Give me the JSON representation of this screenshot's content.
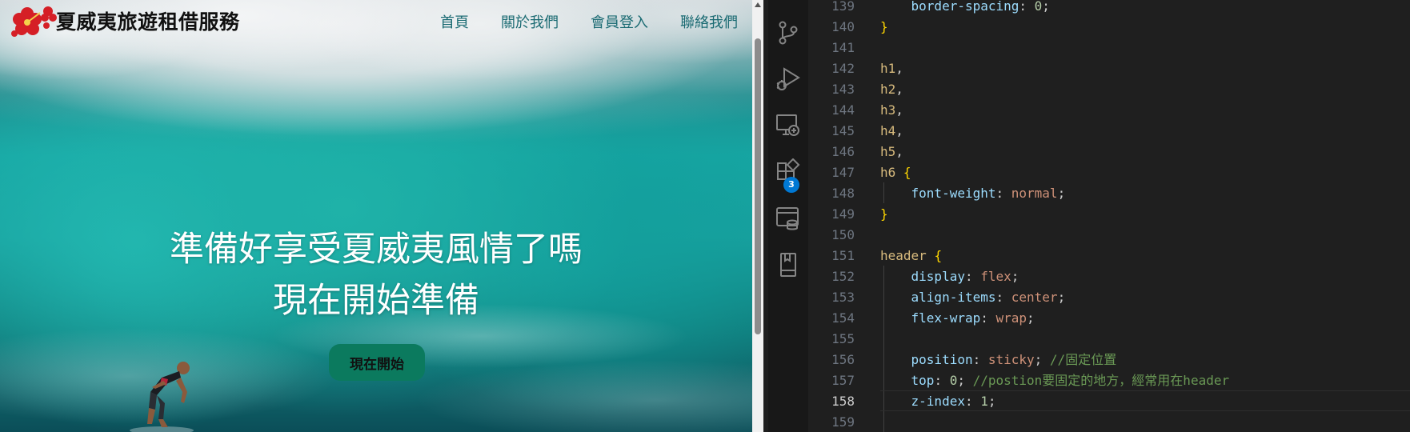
{
  "browser": {
    "brand": "夏威夷旅遊租借服務",
    "nav": [
      {
        "label": "首頁"
      },
      {
        "label": "關於我們"
      },
      {
        "label": "會員登入"
      },
      {
        "label": "聯絡我們"
      }
    ],
    "hero": {
      "line1": "準備好享受夏威夷風情了嗎",
      "line2": "現在開始準備",
      "cta": "現在開始"
    },
    "logo_color": "#d51f26",
    "nav_color": "#1b6b73",
    "cta_color": "#0b7a5e"
  },
  "vscode": {
    "activity_icons": [
      "source-control-icon",
      "run-debug-icon",
      "remote-explorer-icon",
      "extensions-icon",
      "database-icon",
      "bookmark-icon"
    ],
    "extensions_badge": "3",
    "active_line": 158,
    "lines": [
      {
        "n": "139",
        "tokens": [
          {
            "t": "    ",
            "c": "punc"
          },
          {
            "t": "border-spacing",
            "c": "prop"
          },
          {
            "t": ": ",
            "c": "punc"
          },
          {
            "t": "0",
            "c": "num"
          },
          {
            "t": ";",
            "c": "punc"
          }
        ]
      },
      {
        "n": "140",
        "tokens": [
          {
            "t": "}",
            "c": "brace"
          }
        ]
      },
      {
        "n": "141",
        "tokens": []
      },
      {
        "n": "142",
        "tokens": [
          {
            "t": "h1",
            "c": "sel"
          },
          {
            "t": ",",
            "c": "punc"
          }
        ]
      },
      {
        "n": "143",
        "tokens": [
          {
            "t": "h2",
            "c": "sel"
          },
          {
            "t": ",",
            "c": "punc"
          }
        ]
      },
      {
        "n": "144",
        "tokens": [
          {
            "t": "h3",
            "c": "sel"
          },
          {
            "t": ",",
            "c": "punc"
          }
        ]
      },
      {
        "n": "145",
        "tokens": [
          {
            "t": "h4",
            "c": "sel"
          },
          {
            "t": ",",
            "c": "punc"
          }
        ]
      },
      {
        "n": "146",
        "tokens": [
          {
            "t": "h5",
            "c": "sel"
          },
          {
            "t": ",",
            "c": "punc"
          }
        ]
      },
      {
        "n": "147",
        "tokens": [
          {
            "t": "h6",
            "c": "sel"
          },
          {
            "t": " ",
            "c": "punc"
          },
          {
            "t": "{",
            "c": "brace"
          }
        ]
      },
      {
        "n": "148",
        "tokens": [
          {
            "t": "    ",
            "c": "punc"
          },
          {
            "t": "font-weight",
            "c": "prop"
          },
          {
            "t": ": ",
            "c": "punc"
          },
          {
            "t": "normal",
            "c": "val"
          },
          {
            "t": ";",
            "c": "punc"
          }
        ]
      },
      {
        "n": "149",
        "tokens": [
          {
            "t": "}",
            "c": "brace"
          }
        ]
      },
      {
        "n": "150",
        "tokens": []
      },
      {
        "n": "151",
        "tokens": [
          {
            "t": "header",
            "c": "sel"
          },
          {
            "t": " ",
            "c": "punc"
          },
          {
            "t": "{",
            "c": "brace"
          }
        ]
      },
      {
        "n": "152",
        "tokens": [
          {
            "t": "    ",
            "c": "punc"
          },
          {
            "t": "display",
            "c": "prop"
          },
          {
            "t": ": ",
            "c": "punc"
          },
          {
            "t": "flex",
            "c": "val"
          },
          {
            "t": ";",
            "c": "punc"
          }
        ]
      },
      {
        "n": "153",
        "tokens": [
          {
            "t": "    ",
            "c": "punc"
          },
          {
            "t": "align-items",
            "c": "prop"
          },
          {
            "t": ": ",
            "c": "punc"
          },
          {
            "t": "center",
            "c": "val"
          },
          {
            "t": ";",
            "c": "punc"
          }
        ]
      },
      {
        "n": "154",
        "tokens": [
          {
            "t": "    ",
            "c": "punc"
          },
          {
            "t": "flex-wrap",
            "c": "prop"
          },
          {
            "t": ": ",
            "c": "punc"
          },
          {
            "t": "wrap",
            "c": "val"
          },
          {
            "t": ";",
            "c": "punc"
          }
        ]
      },
      {
        "n": "155",
        "tokens": []
      },
      {
        "n": "156",
        "tokens": [
          {
            "t": "    ",
            "c": "punc"
          },
          {
            "t": "position",
            "c": "prop"
          },
          {
            "t": ": ",
            "c": "punc"
          },
          {
            "t": "sticky",
            "c": "val"
          },
          {
            "t": "; ",
            "c": "punc"
          },
          {
            "t": "//固定位置",
            "c": "cmt"
          }
        ]
      },
      {
        "n": "157",
        "tokens": [
          {
            "t": "    ",
            "c": "punc"
          },
          {
            "t": "top",
            "c": "prop"
          },
          {
            "t": ": ",
            "c": "punc"
          },
          {
            "t": "0",
            "c": "num"
          },
          {
            "t": "; ",
            "c": "punc"
          },
          {
            "t": "//postion要固定的地方，經常用在header",
            "c": "cmt"
          }
        ]
      },
      {
        "n": "158",
        "tokens": [
          {
            "t": "    ",
            "c": "punc"
          },
          {
            "t": "z-index",
            "c": "prop"
          },
          {
            "t": ": ",
            "c": "punc"
          },
          {
            "t": "1",
            "c": "num"
          },
          {
            "t": ";",
            "c": "punc"
          }
        ]
      },
      {
        "n": "159",
        "tokens": []
      }
    ]
  }
}
